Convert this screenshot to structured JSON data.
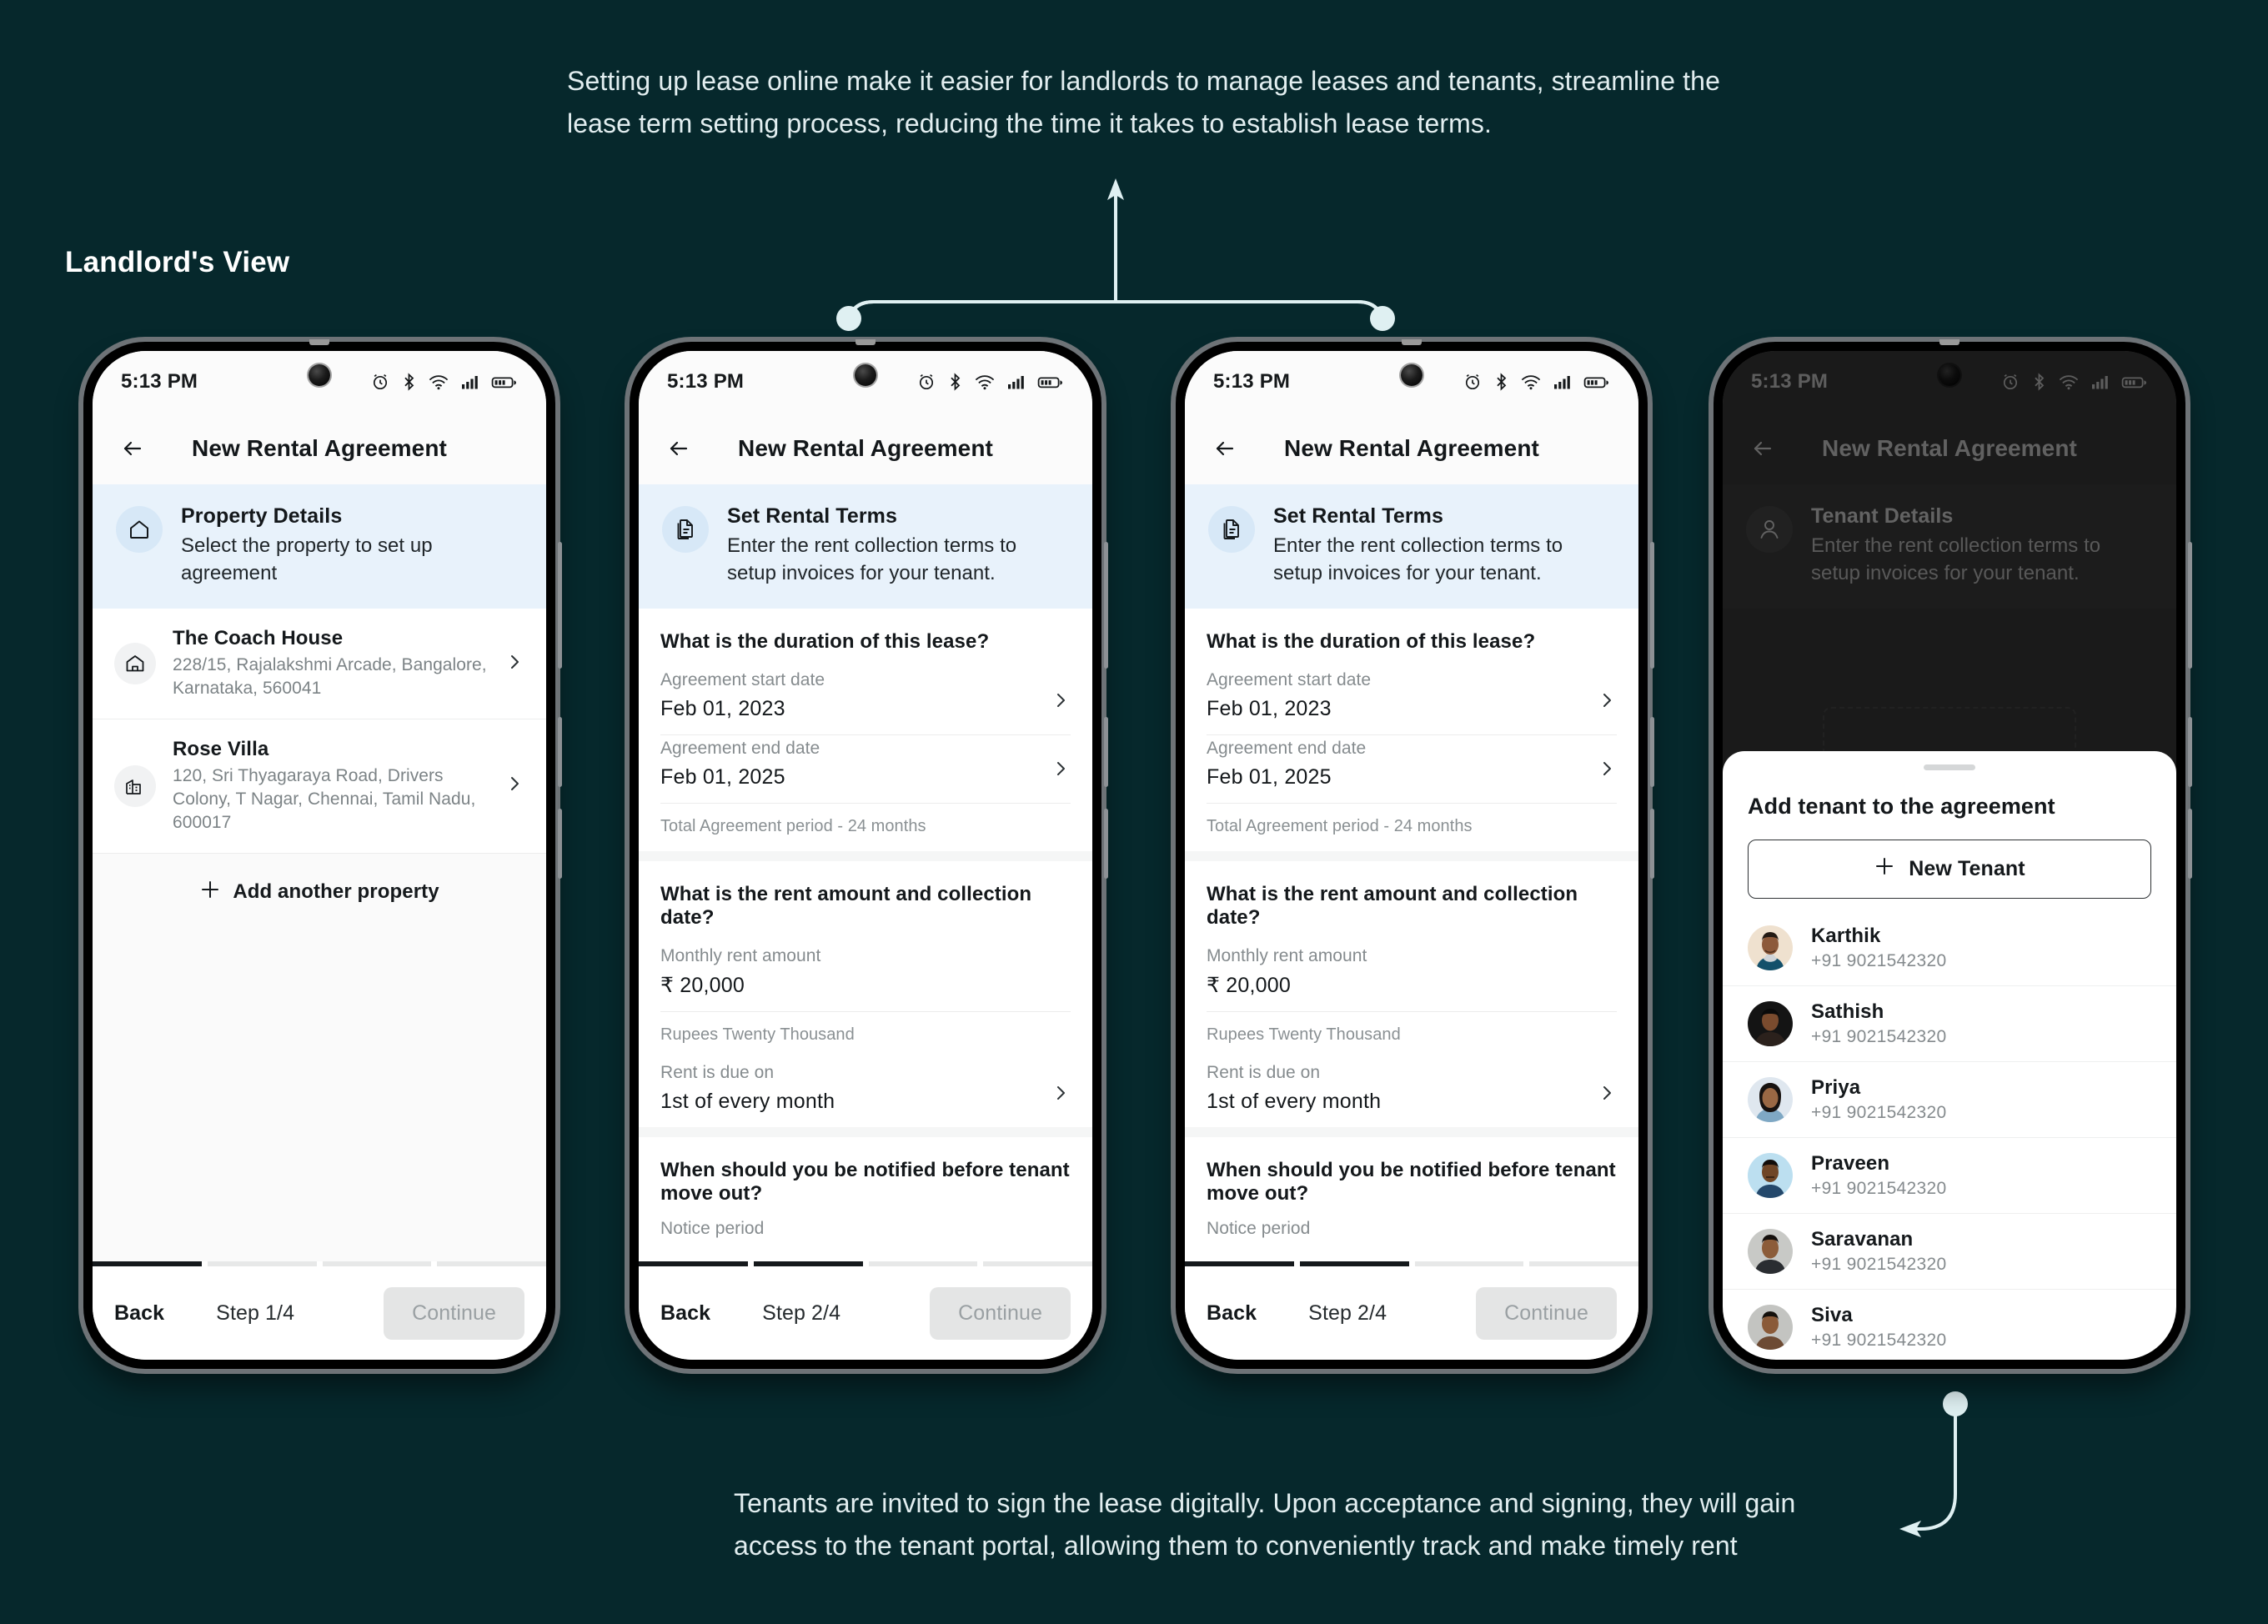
{
  "page": {
    "background_color": "#06282c",
    "top_caption": "Setting up lease online make it easier for landlords to manage leases and tenants, streamline the lease term setting process, reducing the time it takes to establish lease terms.",
    "bottom_caption": "Tenants are invited to sign the lease digitally. Upon acceptance and signing, they will gain access to the tenant portal, allowing them to conveniently track and make timely rent",
    "view_label": "Landlord's View",
    "accent_color": "#d9eef1",
    "banner_color": "#e8f2fb"
  },
  "status_bar": {
    "time": "5:13 PM",
    "icons": [
      "alarm-icon",
      "bluetooth-icon",
      "wifi-icon",
      "cellular-icon",
      "battery-icon"
    ]
  },
  "app": {
    "title": "New Rental Agreement",
    "back_icon": "back-arrow-icon"
  },
  "screens": [
    {
      "id": "property-details",
      "banner": {
        "icon": "home-outline-icon",
        "title": "Property Details",
        "subtitle": "Select the property to set up agreement"
      },
      "properties": [
        {
          "icon": "house-icon",
          "name": "The Coach House",
          "address": "228/15, Rajalakshmi Arcade, Bangalore, Karnataka, 560041"
        },
        {
          "icon": "building-icon",
          "name": "Rose Villa",
          "address": "120, Sri Thyagaraya Road, Drivers Colony, T Nagar, Chennai, Tamil Nadu, 600017"
        }
      ],
      "add_property_label": "Add another property",
      "bottom": {
        "back": "Back",
        "step": "Step 1/4",
        "continue": "Continue",
        "progress_filled": 1,
        "progress_total": 4
      }
    },
    {
      "id": "set-rental-terms",
      "banner": {
        "icon": "document-icon",
        "title": "Set Rental Terms",
        "subtitle": "Enter the rent collection terms to setup invoices for your tenant."
      },
      "sections": [
        {
          "question": "What is the duration of this lease?",
          "fields": [
            {
              "label": "Agreement start date",
              "value": "Feb 01, 2023",
              "chevron": true
            },
            {
              "label": "Agreement end date",
              "value": "Feb 01, 2025",
              "chevron": true
            }
          ],
          "note": "Total Agreement period - 24 months"
        },
        {
          "question": "What is the rent amount and collection date?",
          "fields": [
            {
              "label": "Monthly rent amount",
              "value": "₹  20,000",
              "chevron": false
            }
          ],
          "sub_note": "Rupees Twenty Thousand",
          "fields2": [
            {
              "label": "Rent is due on",
              "value": "1st of every month",
              "chevron": true
            }
          ]
        },
        {
          "question": "When should you be notified before tenant move out?",
          "fields": [
            {
              "label": "Notice period",
              "value": "",
              "chevron": false
            }
          ]
        }
      ],
      "bottom": {
        "back": "Back",
        "step": "Step 2/4",
        "continue": "Continue",
        "progress_filled": 2,
        "progress_total": 4
      }
    },
    {
      "id": "tenant-details",
      "banner": {
        "icon": "person-icon",
        "title": "Tenant Details",
        "subtitle": "Enter the rent collection terms to setup invoices for your tenant."
      },
      "sheet": {
        "title": "Add tenant to the agreement",
        "new_tenant_label": "New Tenant",
        "tenants": [
          {
            "name": "Karthik",
            "phone": "+91 9021542320",
            "avatar_bg": "#efe1cf",
            "skin": "#8d5a3b",
            "hair": "#231a14",
            "shirt": "#13506b"
          },
          {
            "name": "Sathish",
            "phone": "+91 9021542320",
            "avatar_bg": "#141414",
            "skin": "#7a4b2e",
            "hair": "#0a0a0a",
            "shirt": "#2b211c"
          },
          {
            "name": "Priya",
            "phone": "+91 9021542320",
            "avatar_bg": "#dfe7ef",
            "skin": "#9a6844",
            "hair": "#171210",
            "shirt": "#7fa8c4"
          },
          {
            "name": "Praveen",
            "phone": "+91 9021542320",
            "avatar_bg": "#bcdff0",
            "skin": "#6f4627",
            "hair": "#120d0a",
            "shirt": "#24486b"
          },
          {
            "name": "Saravanan",
            "phone": "+91 9021542320",
            "avatar_bg": "#c8c9c6",
            "skin": "#8c5c39",
            "hair": "#15100d",
            "shirt": "#2a2d31"
          },
          {
            "name": "Siva",
            "phone": "+91 9021542320",
            "avatar_bg": "#c3c4c1",
            "skin": "#8a5a38",
            "hair": "#14100c",
            "shirt": "#6d4b34"
          }
        ]
      }
    }
  ]
}
